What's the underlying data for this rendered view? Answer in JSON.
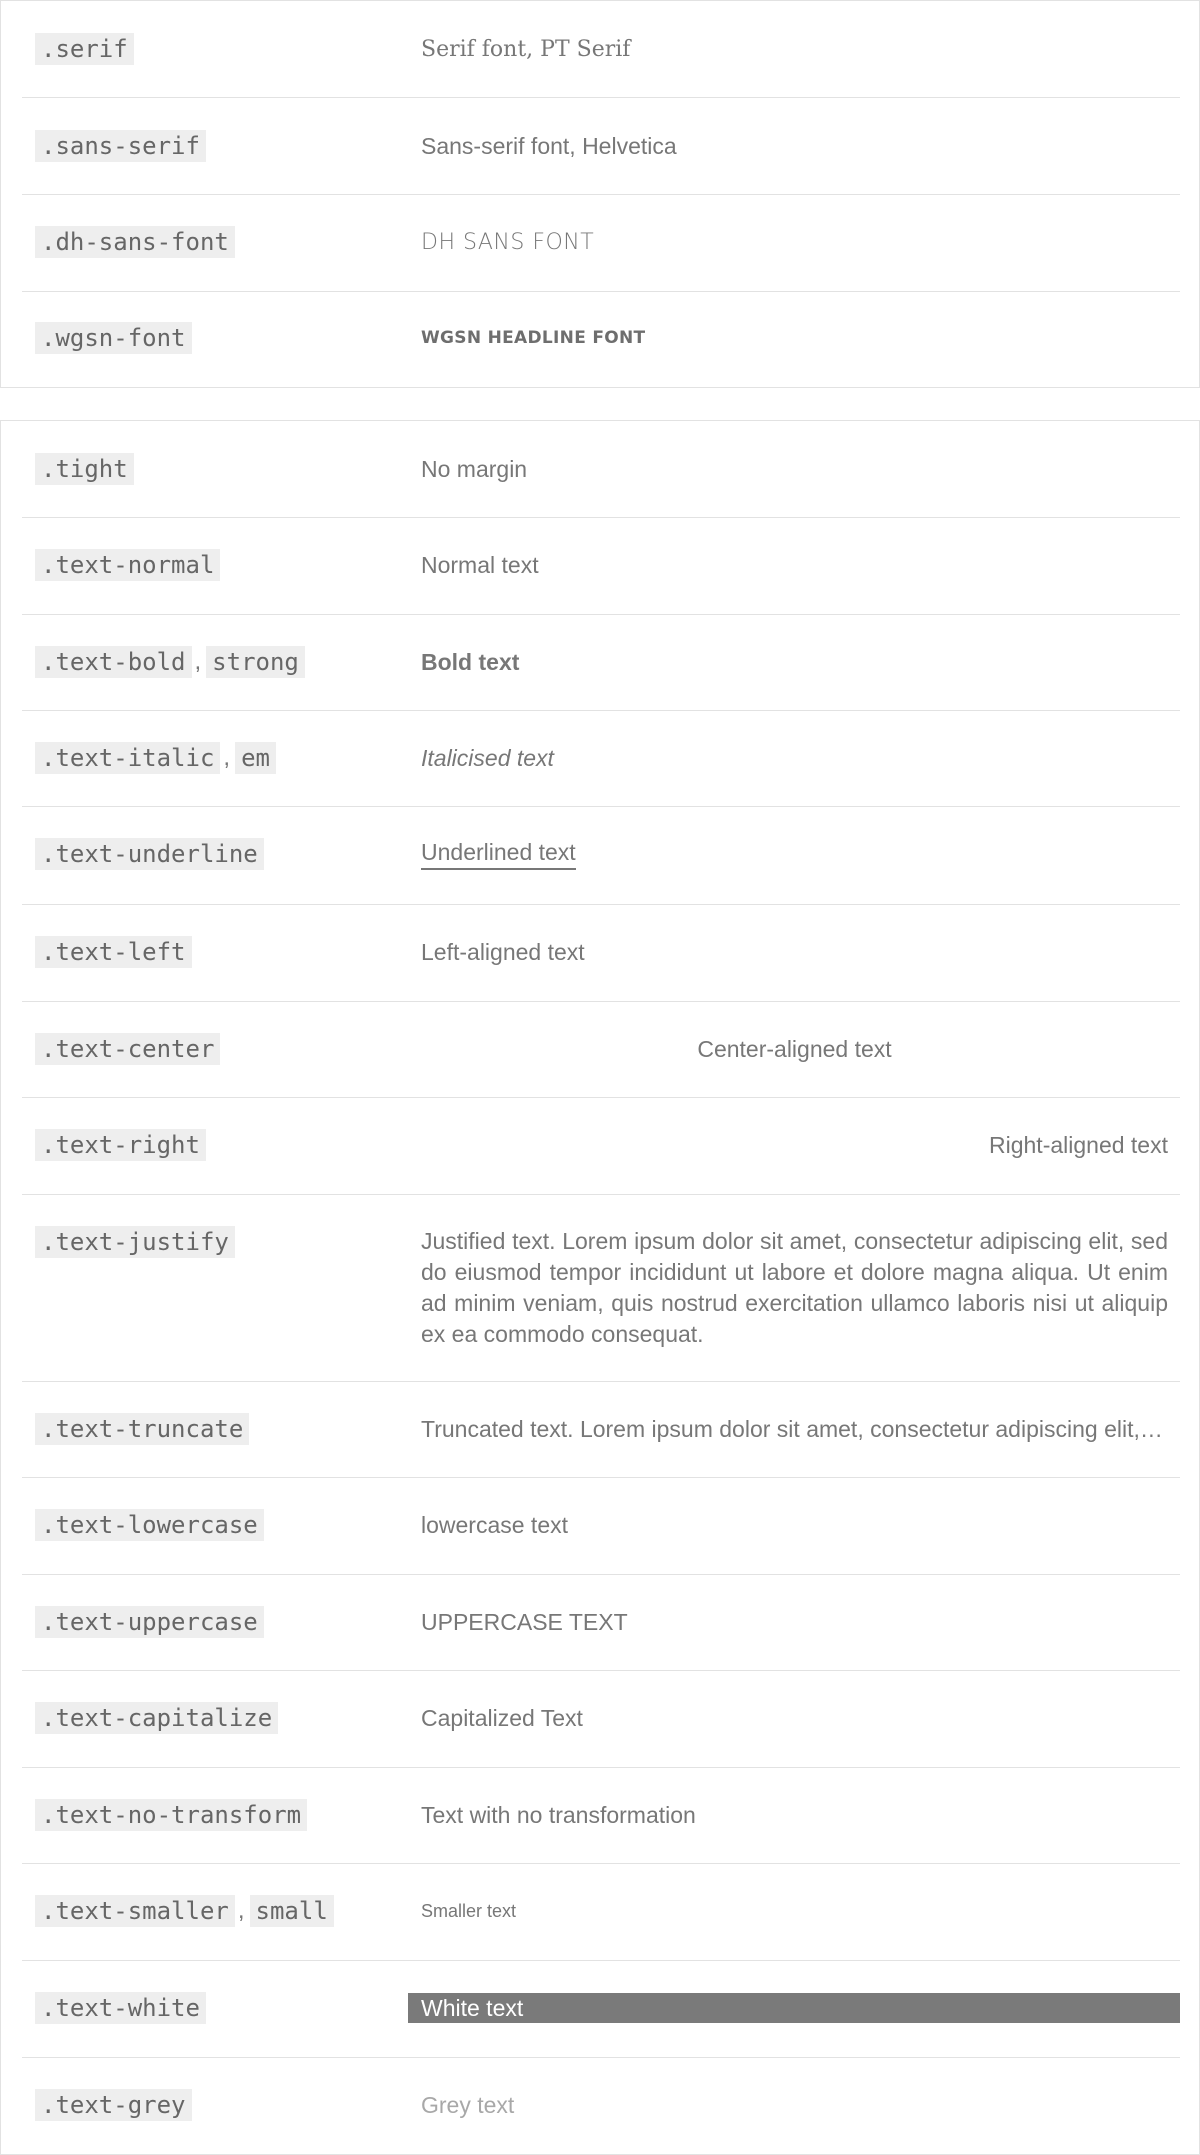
{
  "fonts": [
    {
      "code": ".serif",
      "demo": "Serif font, PT Serif"
    },
    {
      "code": ".sans-serif",
      "demo": "Sans-serif font, Helvetica"
    },
    {
      "code": ".dh-sans-font",
      "demo": "DH SANS FONT"
    },
    {
      "code": ".wgsn-font",
      "demo": "WGSN HEADLINE FONT"
    }
  ],
  "utilities": [
    {
      "codes": [
        ".tight"
      ],
      "demo": "No margin"
    },
    {
      "codes": [
        ".text-normal"
      ],
      "demo": "Normal text"
    },
    {
      "codes": [
        ".text-bold",
        "strong"
      ],
      "separator": ",",
      "demo": "Bold text"
    },
    {
      "codes": [
        ".text-italic",
        "em"
      ],
      "separator": ",",
      "demo": "Italicised text"
    },
    {
      "codes": [
        ".text-underline"
      ],
      "demo": "Underlined text"
    },
    {
      "codes": [
        ".text-left"
      ],
      "demo": "Left-aligned text"
    },
    {
      "codes": [
        ".text-center"
      ],
      "demo": "Center-aligned text"
    },
    {
      "codes": [
        ".text-right"
      ],
      "demo": "Right-aligned text"
    },
    {
      "codes": [
        ".text-justify"
      ],
      "demo": "Justified text. Lorem ipsum dolor sit amet, consectetur adipiscing elit, sed do eiusmod tempor incididunt ut labore et dolore magna aliqua. Ut enim ad minim veniam, quis nostrud exercitation ullamco laboris nisi ut aliquip ex ea commodo consequat."
    },
    {
      "codes": [
        ".text-truncate"
      ],
      "demo": "Truncated text. Lorem ipsum dolor sit amet, consectetur adipiscing elit, s…"
    },
    {
      "codes": [
        ".text-lowercase"
      ],
      "demo": "lowercase text"
    },
    {
      "codes": [
        ".text-uppercase"
      ],
      "demo": "UPPERCASE TEXT"
    },
    {
      "codes": [
        ".text-capitalize"
      ],
      "demo": "Capitalized Text"
    },
    {
      "codes": [
        ".text-no-transform"
      ],
      "demo": "Text with no transformation"
    },
    {
      "codes": [
        ".text-smaller",
        "small"
      ],
      "separator": ",",
      "demo": "Smaller text"
    },
    {
      "codes": [
        ".text-white"
      ],
      "demo": "White text"
    },
    {
      "codes": [
        ".text-grey"
      ],
      "demo": "Grey text"
    }
  ]
}
